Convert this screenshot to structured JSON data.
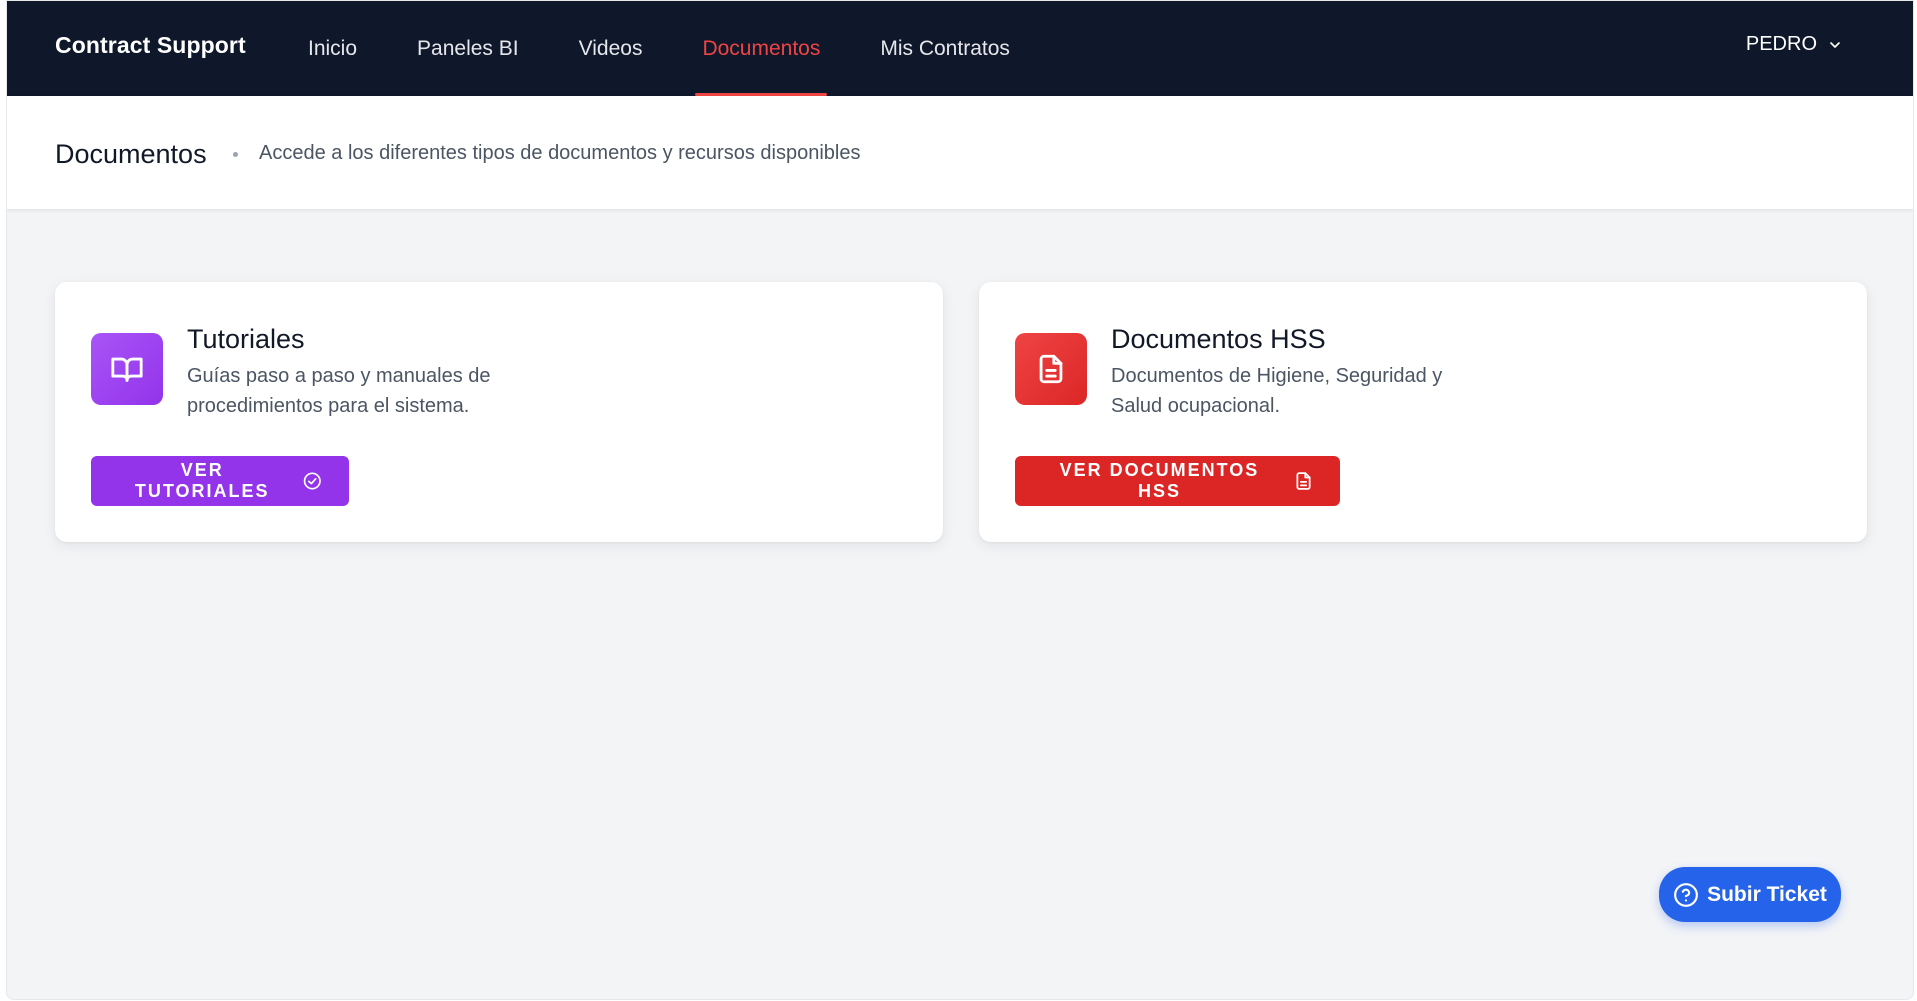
{
  "navbar": {
    "brand": "Contract Support",
    "links": [
      {
        "label": "Inicio"
      },
      {
        "label": "Paneles BI"
      },
      {
        "label": "Videos"
      },
      {
        "label": "Documentos",
        "active": true
      },
      {
        "label": "Mis Contratos"
      }
    ],
    "user": "PEDRO",
    "user_icon": "chevron-down-icon"
  },
  "header": {
    "title": "Documentos",
    "subtitle": "Accede a los diferentes tipos de documentos y recursos disponibles"
  },
  "cards": [
    {
      "title": "Tutoriales",
      "description": "Guías paso a paso y manuales de procedimientos para el sistema.",
      "button_label": "VER TUTORIALES",
      "icon": "book-icon",
      "button_icon": "check-circle-icon",
      "color": "#9333ea"
    },
    {
      "title": "Documentos HSS",
      "description": "Documentos de Higiene, Seguridad y Salud ocupacional.",
      "button_label": "VER DOCUMENTOS HSS",
      "icon": "document-icon",
      "button_icon": "document-icon",
      "color": "#dc2626"
    }
  ],
  "ticket": {
    "label": "Subir Ticket",
    "icon": "help-circle-icon",
    "color": "#2563eb"
  },
  "colors": {
    "nav_bg": "#0f172a",
    "active": "#ef4444",
    "page_bg": "#f3f4f6"
  }
}
